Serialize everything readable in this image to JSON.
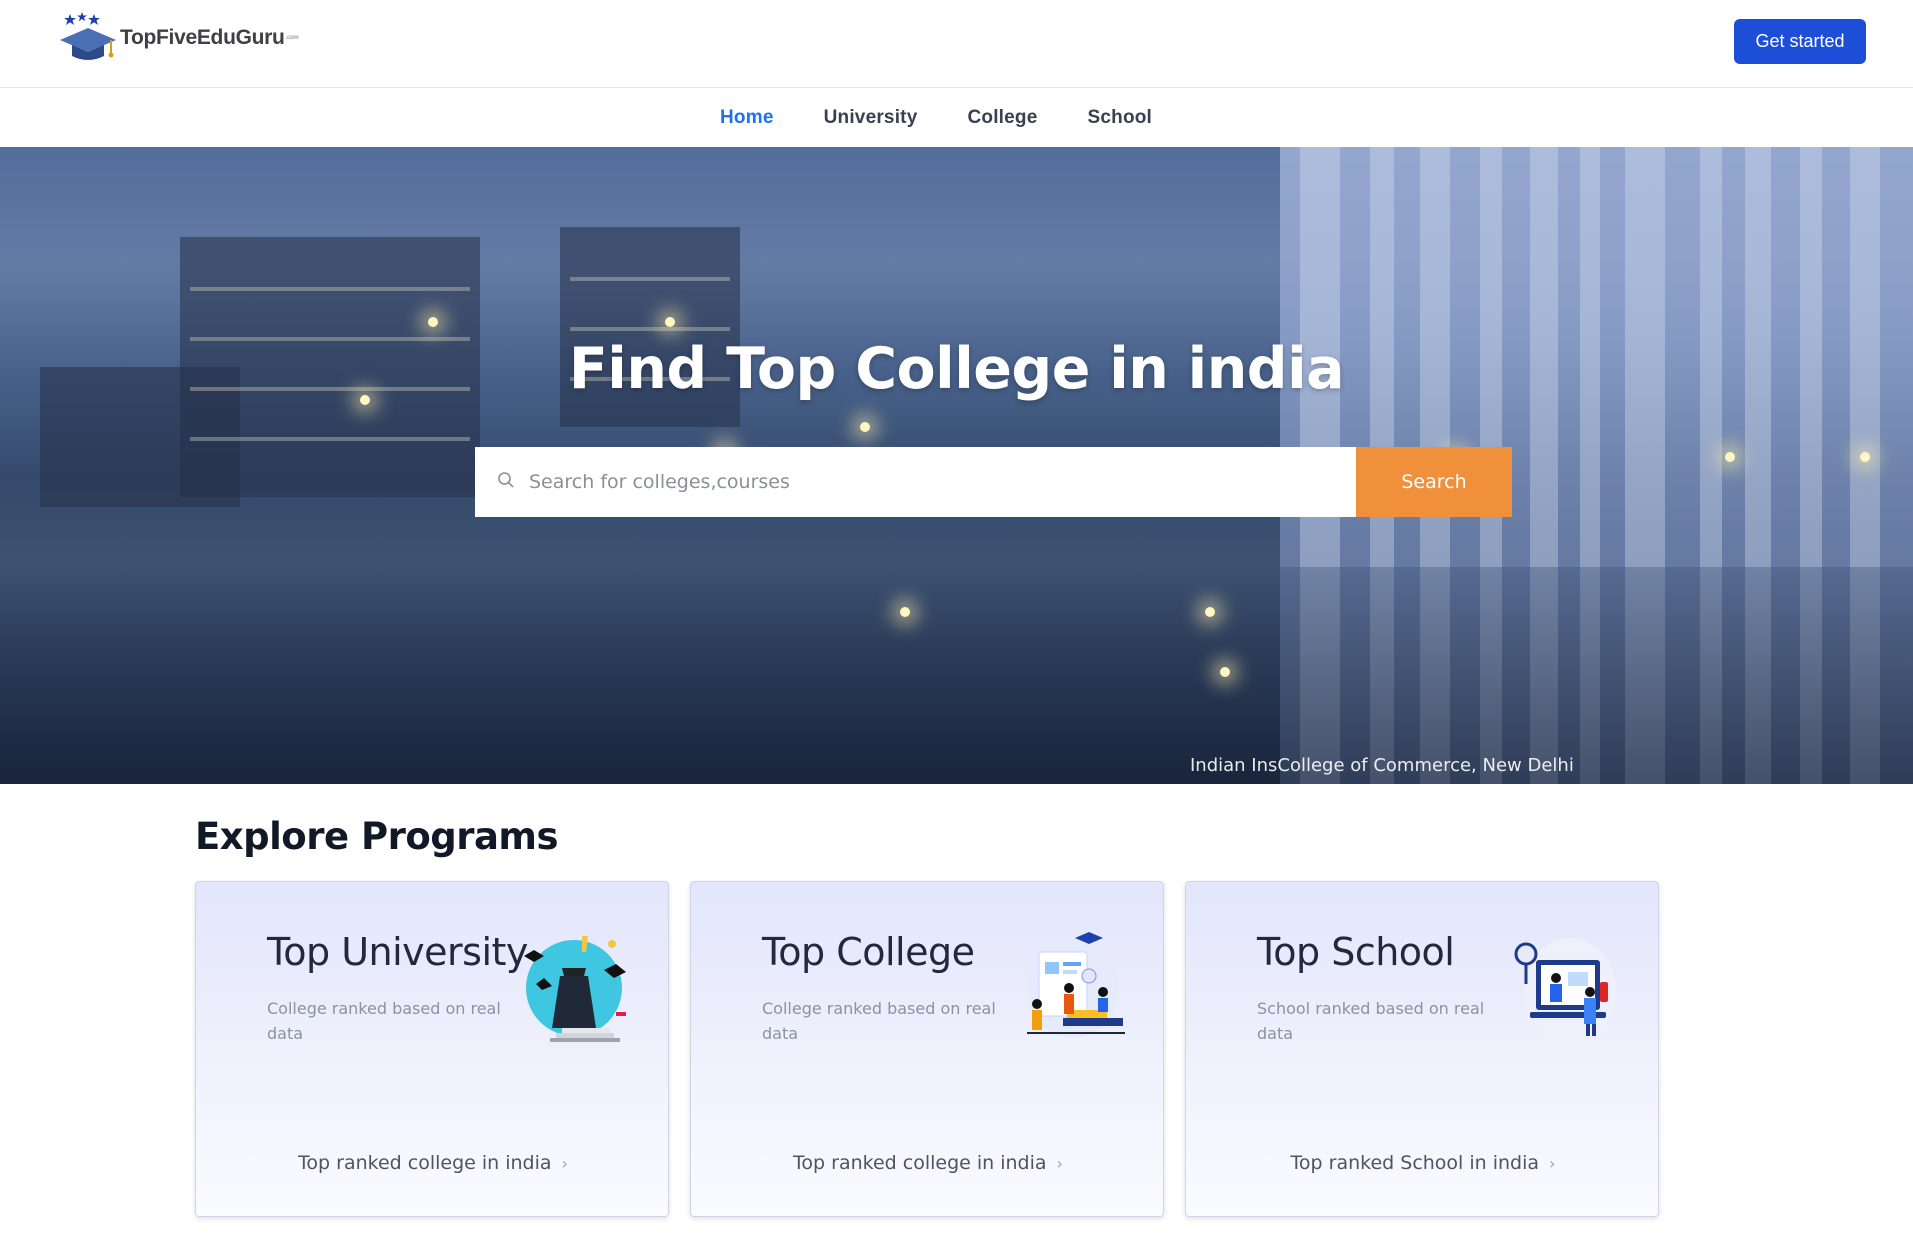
{
  "header": {
    "logo_text": "TopFiveEduGuru",
    "logo_tm": ".com",
    "cta_label": "Get started"
  },
  "nav": {
    "items": [
      {
        "label": "Home",
        "active": true
      },
      {
        "label": "University",
        "active": false
      },
      {
        "label": "College",
        "active": false
      },
      {
        "label": "School",
        "active": false
      }
    ]
  },
  "hero": {
    "title": "Find Top College in india",
    "search_placeholder": "Search for colleges,courses",
    "search_button": "Search",
    "caption": "Indian InsCollege of Commerce, New Delhi"
  },
  "explore": {
    "title": "Explore Programs",
    "cards": [
      {
        "title": "Top University",
        "desc": "College ranked based on real data",
        "link": "Top ranked college in india",
        "icon": "graduation-illustration-icon"
      },
      {
        "title": "Top College",
        "desc": "College ranked based on real data",
        "link": "Top ranked college in india",
        "icon": "study-group-illustration-icon"
      },
      {
        "title": "Top School",
        "desc": "School ranked based on real data",
        "link": "Top ranked School in india",
        "icon": "online-class-illustration-icon"
      }
    ]
  },
  "colors": {
    "primary_button": "#1d4ed8",
    "nav_active": "#1a73e8",
    "search_button": "#f0903b"
  }
}
